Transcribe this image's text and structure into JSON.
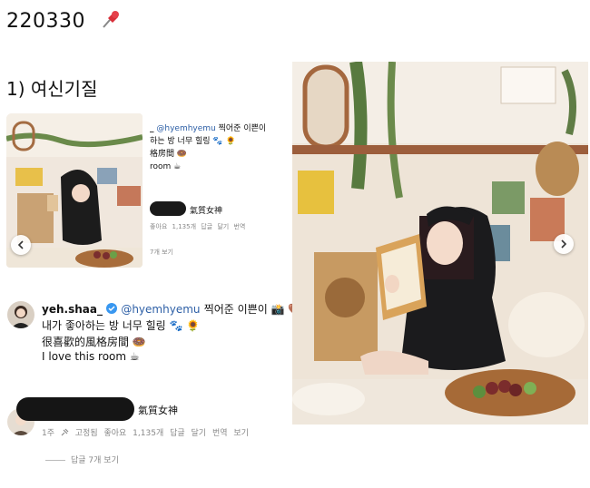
{
  "header": {
    "date": "220330",
    "pin_icon": "pushpin-icon"
  },
  "section": {
    "title": "1) 여신기질"
  },
  "small_post": {
    "username": "_",
    "mention": "@hyemhyemu",
    "line1_tail": "찍어준 이쁜이",
    "line2": "하는 방 너무 힐링 🐾 🌻",
    "line3": "格房間 🍩",
    "line4": "room ☕",
    "reply_name": "氣質女神",
    "reply_meta": "좋아요 1,135개   답글 달기   번역",
    "reply_more": "7개 보기"
  },
  "comment": {
    "username": "yeh.shaa_",
    "mention": "@hyemhyemu",
    "line1_tail": "찍어준 이쁜이 📸 🤎",
    "line2": "내가 좋아하는 방 너무 힐링 🐾 🌻",
    "line3": "很喜歡的風格房間 🍩",
    "line4": "I love this room ☕"
  },
  "reply": {
    "name": "氣質女神",
    "time": "1주",
    "pinned": "고정됨",
    "likes": "좋아요 1,135개",
    "reply_action": "답글 달기",
    "translate": "번역 보기",
    "view_replies": "답글 7개 보기"
  },
  "colors": {
    "mention": "#2d5fa6",
    "redacted": "#151515"
  }
}
